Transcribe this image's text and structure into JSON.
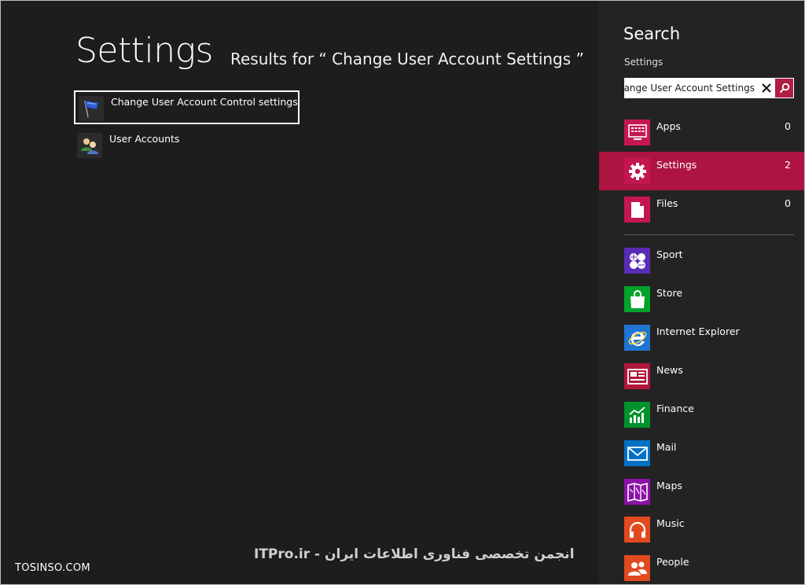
{
  "main": {
    "title": "Settings",
    "results_heading": "Results for “ Change User Account Settings ”",
    "results": [
      {
        "label": "Change User Account Control settings",
        "icon": "uac-flag-icon",
        "selected": true
      },
      {
        "label": "User Accounts",
        "icon": "user-accounts-icon",
        "selected": false
      }
    ]
  },
  "search": {
    "title": "Search",
    "scope": "Settings",
    "query": "Change User Account Settings",
    "categories": [
      {
        "label": "Apps",
        "count": "0",
        "icon": "apps-icon",
        "color": "#c4174f"
      },
      {
        "label": "Settings",
        "count": "2",
        "icon": "gear-icon",
        "color": "#c4174f"
      },
      {
        "label": "Files",
        "count": "0",
        "icon": "file-icon",
        "color": "#c4174f"
      }
    ],
    "apps": [
      {
        "label": "Sport",
        "icon": "sport-icon",
        "color": "#5a2bb5"
      },
      {
        "label": "Store",
        "icon": "store-icon",
        "color": "#00a32a"
      },
      {
        "label": "Internet Explorer",
        "icon": "internet-explorer-icon",
        "color": "#1e76d2"
      },
      {
        "label": "News",
        "icon": "news-icon",
        "color": "#b0163a"
      },
      {
        "label": "Finance",
        "icon": "finance-icon",
        "color": "#00922c"
      },
      {
        "label": "Mail",
        "icon": "mail-icon",
        "color": "#0072c6"
      },
      {
        "label": "Maps",
        "icon": "maps-icon",
        "color": "#8b12a8"
      },
      {
        "label": "Music",
        "icon": "music-icon",
        "color": "#e2491f"
      },
      {
        "label": "People",
        "icon": "people-icon",
        "color": "#e2491f"
      }
    ]
  },
  "watermarks": {
    "left": "TOSINSO.COM",
    "center": "ITPro.ir - انجمن تخصصی فناوری اطلاعات ایران"
  }
}
